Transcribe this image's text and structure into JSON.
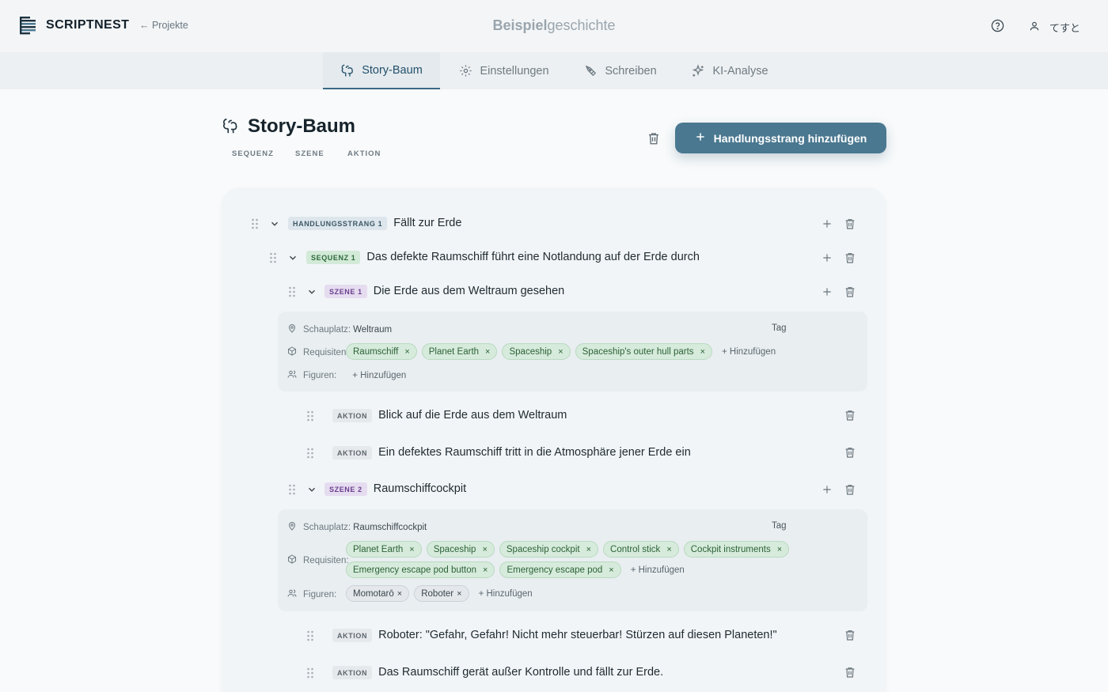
{
  "app": {
    "name": "SCRIPTNEST",
    "back_label": "← Projekte"
  },
  "document": {
    "title_bold": "Beispiel",
    "title_rest": "geschichte"
  },
  "user": {
    "name": "てすと"
  },
  "icons": {
    "help": "help-circle-icon",
    "user": "user-icon",
    "trash": "trash-icon",
    "plus": "plus-icon",
    "grip": "drag-grip-icon",
    "chevron": "chevron-down-icon",
    "tree": "tree-icon",
    "location": "map-pin-icon",
    "box": "box-icon",
    "users": "users-icon"
  },
  "colors": {
    "primary": "#4a7890",
    "accent_tab": "#3b6a84",
    "sequence_badge": "#d3ead8",
    "scene_badge": "#e6dcf0"
  },
  "tabs": [
    {
      "label": "Story-Baum",
      "icon": "tree-icon",
      "active": true
    },
    {
      "label": "Einstellungen",
      "icon": "gear-icon",
      "active": false
    },
    {
      "label": "Schreiben",
      "icon": "pen-tool-icon",
      "active": false
    },
    {
      "label": "KI-Analyse",
      "icon": "sparkles-icon",
      "active": false
    }
  ],
  "page": {
    "title": "Story-Baum",
    "legend": [
      "SEQUENZ",
      "SZENE",
      "AKTION"
    ],
    "add_button": "Handlungsstrang hinzufügen"
  },
  "tree": {
    "strand": {
      "badge": "HANDLUNGSSTRANG 1",
      "title": "Fällt zur Erde"
    },
    "sequence": {
      "badge": "SEQUENZ 1",
      "title": "Das defekte Raumschiff führt eine Notlandung auf der Erde durch"
    },
    "labels": {
      "location": "Schauplatz:",
      "props": "Requisiten:",
      "characters": "Figuren:",
      "add": "+ Hinzufügen"
    },
    "scenes": [
      {
        "badge": "SZENE 1",
        "title": "Die Erde aus dem Weltraum gesehen",
        "location": "Weltraum",
        "time": "Tag",
        "props": [
          "Raumschiff",
          "Planet Earth",
          "Spaceship",
          "Spaceship's outer hull parts"
        ],
        "characters": [],
        "actions": [
          {
            "badge": "AKTION",
            "text": "Blick auf die Erde aus dem Weltraum"
          },
          {
            "badge": "AKTION",
            "text": "Ein defektes Raumschiff tritt in die Atmosphäre jener Erde ein"
          }
        ]
      },
      {
        "badge": "SZENE 2",
        "title": "Raumschiffcockpit",
        "location": "Raumschiffcockpit",
        "time": "Tag",
        "props": [
          "Planet Earth",
          "Spaceship",
          "Spaceship cockpit",
          "Control stick",
          "Cockpit instruments",
          "Emergency escape pod button",
          "Emergency escape pod"
        ],
        "characters": [
          "Momotarō",
          "Roboter"
        ],
        "actions": [
          {
            "badge": "AKTION",
            "text": "Roboter: \"Gefahr, Gefahr! Nicht mehr steuerbar! Stürzen auf diesen Planeten!\""
          },
          {
            "badge": "AKTION",
            "text": "Das Raumschiff gerät außer Kontrolle und fällt zur Erde."
          }
        ]
      }
    ]
  }
}
